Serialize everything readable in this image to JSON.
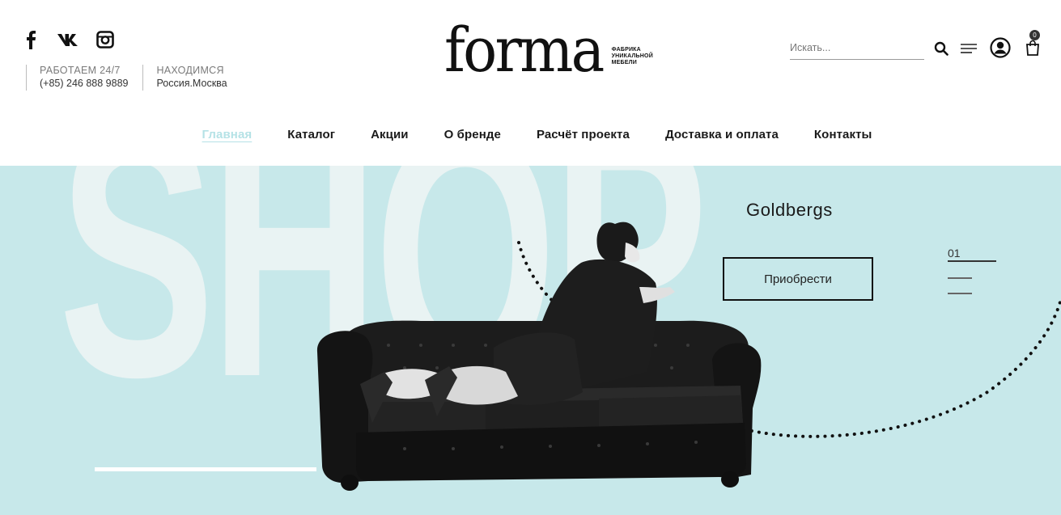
{
  "header": {
    "social": [
      {
        "name": "facebook-icon",
        "glyph": "f"
      },
      {
        "name": "vk-icon",
        "glyph": "vk"
      },
      {
        "name": "instagram-icon",
        "glyph": "instagram"
      }
    ],
    "contacts": [
      {
        "label": "РАБОТАЕМ 24/7",
        "value": "(+85) 246 888 9889"
      },
      {
        "label": "НАХОДИМСЯ",
        "value": "Россия.Москва"
      }
    ],
    "logo": {
      "word": "forma",
      "tagline": [
        "ФАБРИКА",
        "УНИКАЛЬНОЙ",
        "МЕБЕЛИ"
      ]
    },
    "search": {
      "placeholder": "Искать..."
    },
    "cart_count": "0"
  },
  "nav": {
    "items": [
      {
        "label": "Главная",
        "active": true
      },
      {
        "label": "Каталог",
        "active": false
      },
      {
        "label": "Акции",
        "active": false
      },
      {
        "label": "О бренде",
        "active": false
      },
      {
        "label": "Расчёт проекта",
        "active": false
      },
      {
        "label": "Доставка и оплата",
        "active": false
      },
      {
        "label": "Контакты",
        "active": false
      }
    ]
  },
  "hero": {
    "background_word": "SHOP",
    "product_name": "Goldbergs",
    "buy_label": "Приобрести",
    "slide_number": "01",
    "colors": {
      "background": "#c7e8ea",
      "shop_text": "#e9f3f3",
      "nav_active": "#b5e2e6"
    }
  }
}
